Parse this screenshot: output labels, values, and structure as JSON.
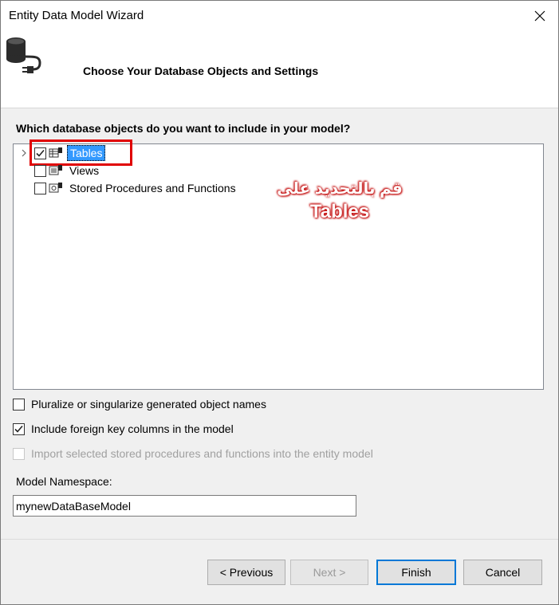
{
  "window": {
    "title": "Entity Data Model Wizard"
  },
  "header": {
    "title": "Choose Your Database Objects and Settings",
    "icon": "database-connect-icon"
  },
  "question": "Which database objects do you want to include in your model?",
  "tree": {
    "items": [
      {
        "label": "Tables",
        "checked": true,
        "selected": true,
        "icon": "table-icon"
      },
      {
        "label": "Views",
        "checked": false,
        "icon": "view-icon"
      },
      {
        "label": "Stored Procedures and Functions",
        "checked": false,
        "icon": "stored-procedure-icon"
      }
    ]
  },
  "annotation": {
    "arabic": "قم بالتحديد على",
    "english": "Tables"
  },
  "options": [
    {
      "label": "Pluralize or singularize generated object names",
      "checked": false,
      "enabled": true
    },
    {
      "label": "Include foreign key columns in the model",
      "checked": true,
      "enabled": true
    },
    {
      "label": "Import selected stored procedures and functions into the entity model",
      "checked": false,
      "enabled": false
    }
  ],
  "namespace": {
    "label": "Model Namespace:",
    "value": "mynewDataBaseModel"
  },
  "buttons": {
    "previous": "< Previous",
    "next": "Next >",
    "finish": "Finish",
    "cancel": "Cancel"
  }
}
